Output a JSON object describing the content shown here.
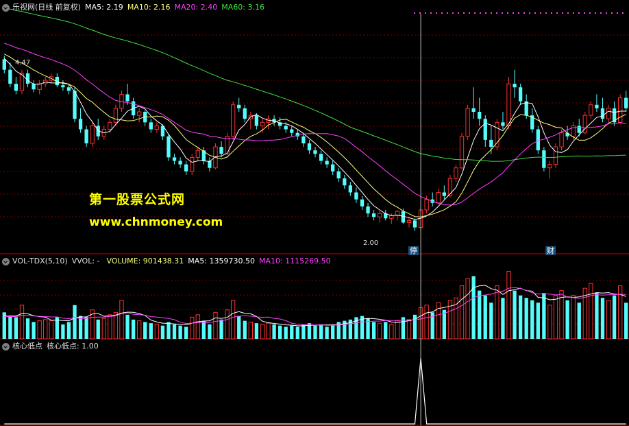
{
  "main_header": {
    "title": "乐视网(日线 前复权)",
    "ma5": {
      "label": "MA5: 2.19",
      "color": "#ffffff"
    },
    "ma10": {
      "label": "MA10: 2.16",
      "color": "#ffff80"
    },
    "ma20": {
      "label": "MA20: 2.40",
      "color": "#ff40ff"
    },
    "ma60": {
      "label": "MA60: 3.16",
      "color": "#40e040"
    }
  },
  "vol_header": {
    "title": "VOL-TDX(5,10)",
    "vvol": "VVOL: -",
    "volume": {
      "label": "VOLUME: 901438.31",
      "color": "#c0c0c0"
    },
    "ma5": {
      "label": "MA5: 1359730.50",
      "color": "#ffffff"
    },
    "ma10": {
      "label": "MA10: 1115269.50",
      "color": "#ff40ff"
    }
  },
  "ind_header": {
    "title": "核心低点",
    "value": {
      "label": "核心低点: 1.00",
      "color": "#c0c0c0"
    }
  },
  "watermark": {
    "line1": "第一股票公式网",
    "line2": "www.chnmoney.com"
  },
  "annotations": {
    "high": "4.47",
    "low": "2.00",
    "tag1": "停",
    "tag2": "财"
  },
  "colors": {
    "up": "#ff3232",
    "down": "#54fcfc",
    "grid": "#800000",
    "crosshair": "#c0c0c0"
  },
  "chart_data": {
    "type": "candlestick",
    "x": [],
    "series": [
      {
        "name": "MA5",
        "values": []
      },
      {
        "name": "MA10",
        "values": []
      },
      {
        "name": "MA20",
        "values": []
      },
      {
        "name": "MA60",
        "values": []
      },
      {
        "name": "VOLUME",
        "values": []
      },
      {
        "name": "核心低点",
        "values": []
      }
    ],
    "ohlc": [
      [
        4.45,
        4.5,
        4.25,
        4.3
      ],
      [
        4.3,
        4.4,
        4.05,
        4.1
      ],
      [
        4.1,
        4.2,
        3.95,
        4.0
      ],
      [
        4.0,
        4.3,
        3.95,
        4.25
      ],
      [
        4.25,
        4.3,
        4.05,
        4.1
      ],
      [
        4.1,
        4.15,
        3.98,
        4.02
      ],
      [
        4.02,
        4.15,
        3.95,
        4.1
      ],
      [
        4.1,
        4.2,
        4.05,
        4.15
      ],
      [
        4.15,
        4.25,
        4.1,
        4.2
      ],
      [
        4.2,
        4.25,
        4.05,
        4.08
      ],
      [
        4.08,
        4.15,
        4.0,
        4.05
      ],
      [
        4.05,
        4.1,
        3.95,
        4.0
      ],
      [
        4.0,
        4.05,
        3.55,
        3.6
      ],
      [
        3.6,
        3.75,
        3.4,
        3.45
      ],
      [
        3.45,
        3.5,
        3.2,
        3.25
      ],
      [
        3.25,
        3.55,
        3.2,
        3.5
      ],
      [
        3.5,
        3.6,
        3.3,
        3.35
      ],
      [
        3.35,
        3.5,
        3.3,
        3.45
      ],
      [
        3.45,
        3.6,
        3.4,
        3.55
      ],
      [
        3.55,
        3.8,
        3.5,
        3.75
      ],
      [
        3.75,
        4.0,
        3.7,
        3.95
      ],
      [
        3.95,
        4.1,
        3.8,
        3.85
      ],
      [
        3.85,
        3.9,
        3.6,
        3.65
      ],
      [
        3.65,
        3.75,
        3.55,
        3.7
      ],
      [
        3.7,
        3.72,
        3.5,
        3.55
      ],
      [
        3.55,
        3.6,
        3.4,
        3.45
      ],
      [
        3.45,
        3.55,
        3.4,
        3.5
      ],
      [
        3.5,
        3.52,
        3.3,
        3.35
      ],
      [
        3.35,
        3.38,
        3.0,
        3.05
      ],
      [
        3.05,
        3.1,
        2.95,
        3.0
      ],
      [
        3.0,
        3.05,
        2.9,
        2.95
      ],
      [
        2.95,
        3.0,
        2.8,
        2.85
      ],
      [
        2.85,
        3.1,
        2.8,
        3.05
      ],
      [
        3.05,
        3.2,
        3.0,
        3.15
      ],
      [
        3.15,
        3.2,
        2.95,
        3.0
      ],
      [
        3.0,
        3.05,
        2.85,
        2.9
      ],
      [
        2.9,
        3.25,
        2.88,
        3.2
      ],
      [
        3.2,
        3.28,
        3.05,
        3.1
      ],
      [
        3.1,
        3.4,
        3.08,
        3.35
      ],
      [
        3.35,
        3.85,
        3.3,
        3.8
      ],
      [
        3.8,
        3.9,
        3.7,
        3.75
      ],
      [
        3.75,
        3.8,
        3.55,
        3.6
      ],
      [
        3.6,
        3.7,
        3.45,
        3.65
      ],
      [
        3.65,
        3.68,
        3.45,
        3.5
      ],
      [
        3.5,
        3.6,
        3.4,
        3.55
      ],
      [
        3.55,
        3.65,
        3.45,
        3.6
      ],
      [
        3.6,
        3.65,
        3.5,
        3.55
      ],
      [
        3.55,
        3.62,
        3.45,
        3.5
      ],
      [
        3.5,
        3.55,
        3.4,
        3.45
      ],
      [
        3.45,
        3.5,
        3.35,
        3.4
      ],
      [
        3.4,
        3.45,
        3.3,
        3.35
      ],
      [
        3.35,
        3.4,
        3.2,
        3.25
      ],
      [
        3.25,
        3.3,
        3.1,
        3.15
      ],
      [
        3.15,
        3.2,
        3.05,
        3.1
      ],
      [
        3.1,
        3.15,
        2.95,
        3.0
      ],
      [
        3.0,
        3.05,
        2.9,
        2.95
      ],
      [
        2.95,
        3.0,
        2.8,
        2.85
      ],
      [
        2.85,
        2.9,
        2.7,
        2.75
      ],
      [
        2.75,
        2.8,
        2.6,
        2.65
      ],
      [
        2.65,
        2.7,
        2.5,
        2.55
      ],
      [
        2.55,
        2.62,
        2.4,
        2.45
      ],
      [
        2.45,
        2.5,
        2.3,
        2.35
      ],
      [
        2.35,
        2.4,
        2.2,
        2.25
      ],
      [
        2.25,
        2.3,
        2.15,
        2.2
      ],
      [
        2.2,
        2.28,
        2.12,
        2.25
      ],
      [
        2.25,
        2.3,
        2.15,
        2.18
      ],
      [
        2.18,
        2.25,
        2.1,
        2.22
      ],
      [
        2.22,
        2.3,
        2.15,
        2.28
      ],
      [
        2.28,
        2.32,
        2.1,
        2.12
      ],
      [
        2.12,
        2.2,
        2.05,
        2.15
      ],
      [
        2.15,
        2.18,
        2.0,
        2.05
      ],
      [
        2.05,
        2.35,
        2.0,
        2.3
      ],
      [
        2.3,
        2.5,
        2.25,
        2.45
      ],
      [
        2.45,
        2.55,
        2.35,
        2.4
      ],
      [
        2.4,
        2.6,
        2.38,
        2.55
      ],
      [
        2.55,
        2.65,
        2.45,
        2.5
      ],
      [
        2.5,
        2.8,
        2.48,
        2.75
      ],
      [
        2.75,
        2.95,
        2.7,
        2.9
      ],
      [
        2.9,
        3.4,
        2.88,
        3.35
      ],
      [
        3.35,
        3.8,
        3.3,
        3.75
      ],
      [
        3.75,
        4.05,
        3.6,
        3.7
      ],
      [
        3.7,
        3.9,
        3.5,
        3.6
      ],
      [
        3.6,
        3.65,
        3.2,
        3.3
      ],
      [
        3.3,
        3.5,
        3.1,
        3.2
      ],
      [
        3.2,
        3.6,
        3.15,
        3.55
      ],
      [
        3.55,
        3.7,
        3.45,
        3.5
      ],
      [
        3.5,
        4.2,
        3.45,
        4.1
      ],
      [
        4.1,
        4.3,
        3.9,
        4.05
      ],
      [
        4.05,
        4.1,
        3.8,
        3.85
      ],
      [
        3.85,
        3.95,
        3.6,
        3.65
      ],
      [
        3.65,
        3.75,
        3.4,
        3.45
      ],
      [
        3.45,
        3.5,
        3.1,
        3.15
      ],
      [
        3.15,
        3.2,
        2.85,
        2.9
      ],
      [
        2.9,
        3.0,
        2.75,
        2.95
      ],
      [
        2.95,
        3.25,
        2.9,
        3.2
      ],
      [
        3.2,
        3.45,
        3.15,
        3.4
      ],
      [
        3.4,
        3.5,
        3.3,
        3.35
      ],
      [
        3.35,
        3.55,
        3.3,
        3.5
      ],
      [
        3.5,
        3.6,
        3.35,
        3.4
      ],
      [
        3.4,
        3.7,
        3.38,
        3.65
      ],
      [
        3.65,
        3.85,
        3.6,
        3.8
      ],
      [
        3.8,
        3.95,
        3.7,
        3.75
      ],
      [
        3.75,
        3.9,
        3.55,
        3.6
      ],
      [
        3.6,
        3.8,
        3.55,
        3.75
      ],
      [
        3.75,
        3.85,
        3.5,
        3.55
      ],
      [
        3.55,
        3.95,
        3.52,
        3.9
      ],
      [
        3.9,
        4.0,
        3.7,
        3.75
      ]
    ],
    "volume": [
      1.1,
      0.95,
      0.9,
      1.4,
      0.85,
      0.7,
      0.75,
      0.8,
      0.75,
      0.9,
      0.6,
      0.7,
      1.4,
      0.95,
      0.9,
      1.2,
      0.8,
      0.85,
      1.0,
      1.1,
      1.6,
      1.0,
      0.8,
      0.75,
      0.7,
      0.65,
      0.6,
      0.55,
      0.7,
      0.6,
      0.55,
      0.5,
      0.9,
      1.0,
      0.75,
      0.6,
      1.1,
      0.8,
      1.2,
      1.6,
      0.95,
      0.75,
      0.7,
      0.65,
      0.6,
      0.65,
      0.6,
      0.55,
      0.5,
      0.55,
      0.5,
      0.6,
      0.65,
      0.55,
      0.6,
      0.5,
      0.6,
      0.7,
      0.75,
      0.8,
      0.9,
      0.95,
      0.85,
      0.7,
      0.65,
      0.7,
      0.6,
      0.75,
      0.9,
      0.8,
      1.0,
      1.3,
      1.4,
      1.1,
      1.5,
      1.2,
      1.6,
      1.7,
      2.2,
      2.5,
      2.6,
      2.0,
      1.8,
      1.5,
      2.2,
      1.7,
      2.8,
      2.0,
      1.8,
      1.7,
      1.6,
      1.5,
      1.9,
      1.4,
      1.8,
      2.0,
      1.6,
      1.8,
      1.5,
      2.1,
      2.3,
      1.9,
      1.7,
      1.6,
      1.8,
      2.2,
      1.5
    ],
    "signal_index": 71,
    "y_main": [
      1.85,
      5.1
    ],
    "y_ind": [
      0,
      1.0
    ]
  }
}
